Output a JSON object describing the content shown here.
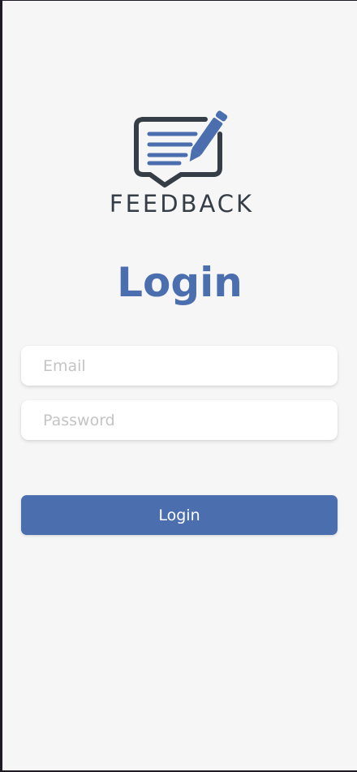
{
  "logo": {
    "text": "FEEDBACK",
    "icon": "feedback-pencil-icon",
    "colors": {
      "outline": "#353d46",
      "accent": "#4b6fae"
    }
  },
  "title": "Login",
  "form": {
    "email_placeholder": "Email",
    "password_placeholder": "Password",
    "submit_label": "Login"
  },
  "colors": {
    "primary": "#4b6fae",
    "background": "#f6f6f6",
    "placeholder": "#c4c4c4"
  }
}
